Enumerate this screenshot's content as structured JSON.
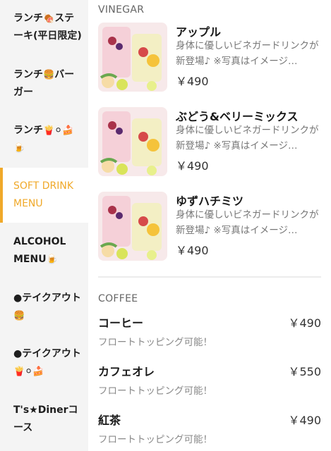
{
  "sidebar": {
    "items": [
      {
        "label": "ランチ",
        "emoji": "🍖",
        "label2": "ステーキ(平日限定)",
        "active": false
      },
      {
        "label": "ランチ",
        "emoji": "🍔",
        "label2": "バーガー",
        "active": false
      },
      {
        "label": "ランチ",
        "emoji": "🍟⚪🍰🍺",
        "label2": "",
        "active": false
      },
      {
        "label": "SOFT DRINK MENU",
        "emoji": "",
        "label2": "",
        "active": true
      },
      {
        "label": "ALCOHOL MENU",
        "emoji": "🍺",
        "label2": "",
        "active": false
      },
      {
        "label": "●テイクアウト",
        "emoji": "🍔",
        "label2": "",
        "active": false
      },
      {
        "label": "●テイクアウト",
        "emoji": "🍟⚪🍰",
        "label2": "",
        "active": false
      },
      {
        "label": "T's★Dinerコース",
        "emoji": "",
        "label2": "",
        "active": false
      }
    ]
  },
  "main": {
    "vinegar": {
      "title": "VINEGAR",
      "items": [
        {
          "name": "アップル",
          "desc": "身体に優しいビネガードリンクが新登場♪ ※写真はイメージ…",
          "price": "￥490"
        },
        {
          "name": "ぶどう&ベリーミックス",
          "desc": "身体に優しいビネガードリンクが新登場♪ ※写真はイメージ…",
          "price": "￥490"
        },
        {
          "name": "ゆずハチミツ",
          "desc": "身体に優しいビネガードリンクが新登場♪ ※写真はイメージ…",
          "price": "￥490"
        }
      ]
    },
    "coffee": {
      "title": "COFFEE",
      "items": [
        {
          "name": "コーヒー",
          "desc": "フロートトッピング可能！",
          "price": "￥490"
        },
        {
          "name": "カフェオレ",
          "desc": "フロートトッピング可能！",
          "price": "￥550"
        },
        {
          "name": "紅茶",
          "desc": "フロートトッピング可能！",
          "price": "￥490"
        }
      ]
    }
  },
  "colors": {
    "accent": "#f0a92a",
    "sidebar_bg": "#f4f4f4"
  },
  "icons": {
    "drink_thumbnail": "vinegar-drink-photo"
  }
}
